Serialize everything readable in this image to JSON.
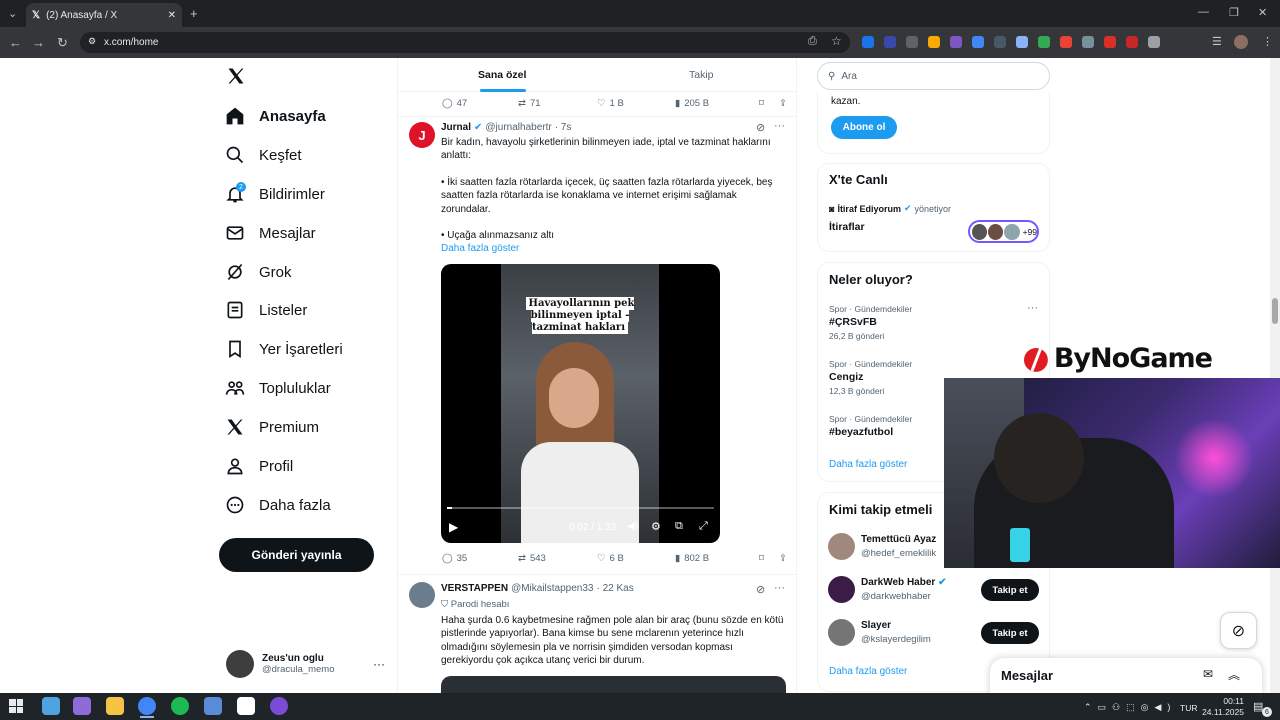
{
  "browser": {
    "tab_title": "(2) Anasayfa / X",
    "url": "x.com/home"
  },
  "nav": {
    "items": [
      {
        "label": "Anasayfa",
        "icon": "home-icon"
      },
      {
        "label": "Keşfet",
        "icon": "search-icon"
      },
      {
        "label": "Bildirimler",
        "icon": "bell-icon",
        "badge": "2"
      },
      {
        "label": "Mesajlar",
        "icon": "mail-icon"
      },
      {
        "label": "Grok",
        "icon": "grok-icon"
      },
      {
        "label": "Listeler",
        "icon": "list-icon"
      },
      {
        "label": "Yer İşaretleri",
        "icon": "bookmark-icon"
      },
      {
        "label": "Topluluklar",
        "icon": "communities-icon"
      },
      {
        "label": "Premium",
        "icon": "x-logo-icon"
      },
      {
        "label": "Profil",
        "icon": "person-icon"
      },
      {
        "label": "Daha fazla",
        "icon": "more-circle-icon"
      }
    ],
    "post_button": "Gönderi yayınla",
    "account": {
      "name": "Zeus'un oglu",
      "handle": "@dracula_memo"
    }
  },
  "feed": {
    "tabs": [
      "Sana özel",
      "Takip"
    ],
    "prev_actions": {
      "replies": "47",
      "reposts": "71",
      "likes": "1 B",
      "views": "205 B"
    },
    "tweet1": {
      "name": "Jurnal",
      "handle": "@jurnalhabertr",
      "time": "· 7s",
      "text1": "Bir kadın, havayolu şirketlerinin bilinmeyen iade, iptal ve tazminat haklarını anlattı:",
      "text2": "• İki saatten fazla rötarlarda içecek, üç saatten fazla rötarlarda yiyecek, beş saatten fazla rötarlarda ise konaklama ve internet erişimi sağlamak zorundalar.",
      "text3": "• Uçağa alınmazsanız altı",
      "show_more": "Daha fazla göster",
      "video_caption": "Havayollarının pek bilinmeyen iptal - tazminat hakları",
      "video_time": "0:02 / 1:32",
      "video_progress": 0.02,
      "actions": {
        "replies": "35",
        "reposts": "543",
        "likes": "6 B",
        "views": "802 B"
      }
    },
    "tweet2": {
      "name": "VERSTAPPEN",
      "handle": "@Mikailstappen33",
      "time": "· 22 Kas",
      "parody": "Parodi hesabı",
      "text": "Haha şurda 0.6 kaybetmesine rağmen pole alan bir araç (bunu sözde en kötü pistlerinde yapıyorlar). Bana kimse bu sene mclarenın yeterince hızlı olmadığını söylemesin pla ve norrisin şimdiden versodan kopması gerekiyordu çok açıkca utanç verici bir durum."
    }
  },
  "sidebar": {
    "search_placeholder": "Ara",
    "premium_text": "kazan.",
    "subscribe": "Abone ol",
    "live": {
      "title": "X'te Canlı",
      "host": "İtiraf Ediyorum",
      "host_role": "yönetiyor",
      "space": "İtiraflar",
      "count": "+99"
    },
    "trends": {
      "title": "Neler oluyor?",
      "items": [
        {
          "meta": "Spor · Gündemdekiler",
          "name": "#ÇRSvFB",
          "posts": "26,2 B gönderi"
        },
        {
          "meta": "Spor · Gündemdekiler",
          "name": "Cengiz",
          "posts": "12,3 B gönderi"
        },
        {
          "meta": "Spor · Gündemdekiler",
          "name": "#beyazfutbol",
          "posts": ""
        }
      ],
      "show_more": "Daha fazla göster"
    },
    "who_to_follow": {
      "title": "Kimi takip etmeli",
      "items": [
        {
          "name": "Temettücü Ayaz",
          "handle": "@hedef_emeklilik",
          "button": ""
        },
        {
          "name": "DarkWeb Haber",
          "handle": "@darkwebhaber",
          "button": "Takip et"
        },
        {
          "name": "Slayer",
          "handle": "@kslayerdegilim",
          "button": "Takip et"
        }
      ],
      "show_more": "Daha fazla göster"
    },
    "messages": "Mesajlar"
  },
  "overlay": {
    "brand": "ByNoGame"
  },
  "taskbar": {
    "time": "00:11",
    "date": "24.11.2025",
    "lang": "TUR",
    "notif": "6"
  },
  "colors": {
    "accent": "#1d9bf0",
    "text": "#0f1419",
    "muted": "#536471"
  }
}
